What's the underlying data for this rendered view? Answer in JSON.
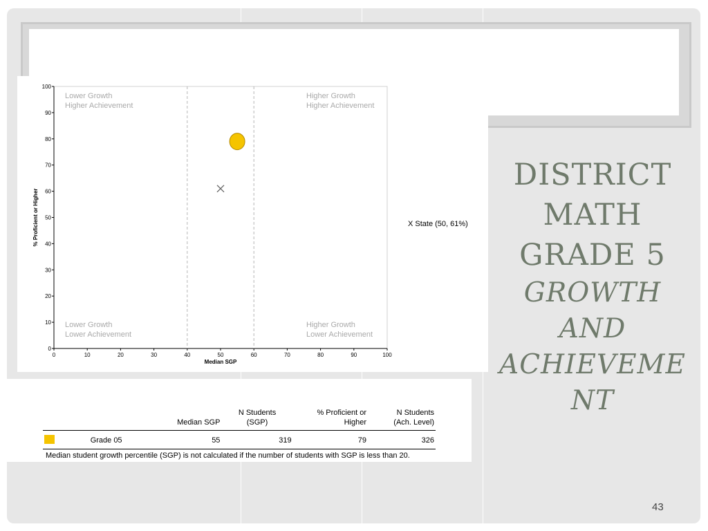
{
  "slide": {
    "title_upper": [
      "DISTRICT",
      "MATH",
      "GRADE 5"
    ],
    "title_italic": [
      "GROWTH",
      "AND",
      "ACHIEVEME",
      "NT"
    ],
    "slide_number": "43"
  },
  "chart_data": {
    "type": "scatter",
    "title": "",
    "xlabel": "Median SGP",
    "ylabel": "% Proficient or Higher",
    "xlim": [
      0,
      100
    ],
    "ylim": [
      0,
      100
    ],
    "xticks": [
      0,
      10,
      20,
      30,
      40,
      50,
      60,
      70,
      80,
      90,
      100
    ],
    "yticks": [
      0,
      10,
      20,
      30,
      40,
      50,
      60,
      70,
      80,
      90,
      100
    ],
    "reference_lines_x": [
      40,
      60
    ],
    "quadrant_labels": {
      "top_left": [
        "Lower Growth",
        "Higher Achievement"
      ],
      "top_right": [
        "Higher Growth",
        "Higher Achievement"
      ],
      "bottom_left": [
        "Lower Growth",
        "Lower Achievement"
      ],
      "bottom_right": [
        "Higher Growth",
        "Lower Achievement"
      ]
    },
    "points": [
      {
        "name": "Grade 05",
        "x": 55,
        "y": 79,
        "marker": "circle",
        "color": "#f5c400"
      },
      {
        "name": "State",
        "x": 50,
        "y": 61,
        "marker": "x",
        "color": "#666666"
      }
    ],
    "state_legend": {
      "marker_text": "X",
      "label": "State (50, 61%)"
    }
  },
  "table": {
    "headers": [
      "",
      "",
      "Median SGP",
      "N Students (SGP)",
      "% Proficient or Higher",
      "N Students (Ach. Level)"
    ],
    "header_lines": [
      [
        "",
        ""
      ],
      [
        "",
        ""
      ],
      [
        "",
        "Median SGP"
      ],
      [
        "N Students",
        "(SGP)"
      ],
      [
        "% Proficient or",
        "Higher"
      ],
      [
        "N Students",
        "(Ach. Level)"
      ]
    ],
    "rows": [
      {
        "label": "Grade 05",
        "median_sgp": "55",
        "n_students_sgp": "319",
        "pct_proficient": "79",
        "n_students_ach": "326",
        "swatch_color": "#f5c400"
      }
    ],
    "note": "Median student growth percentile (SGP) is not calculated if the number of students with SGP is less than 20."
  }
}
